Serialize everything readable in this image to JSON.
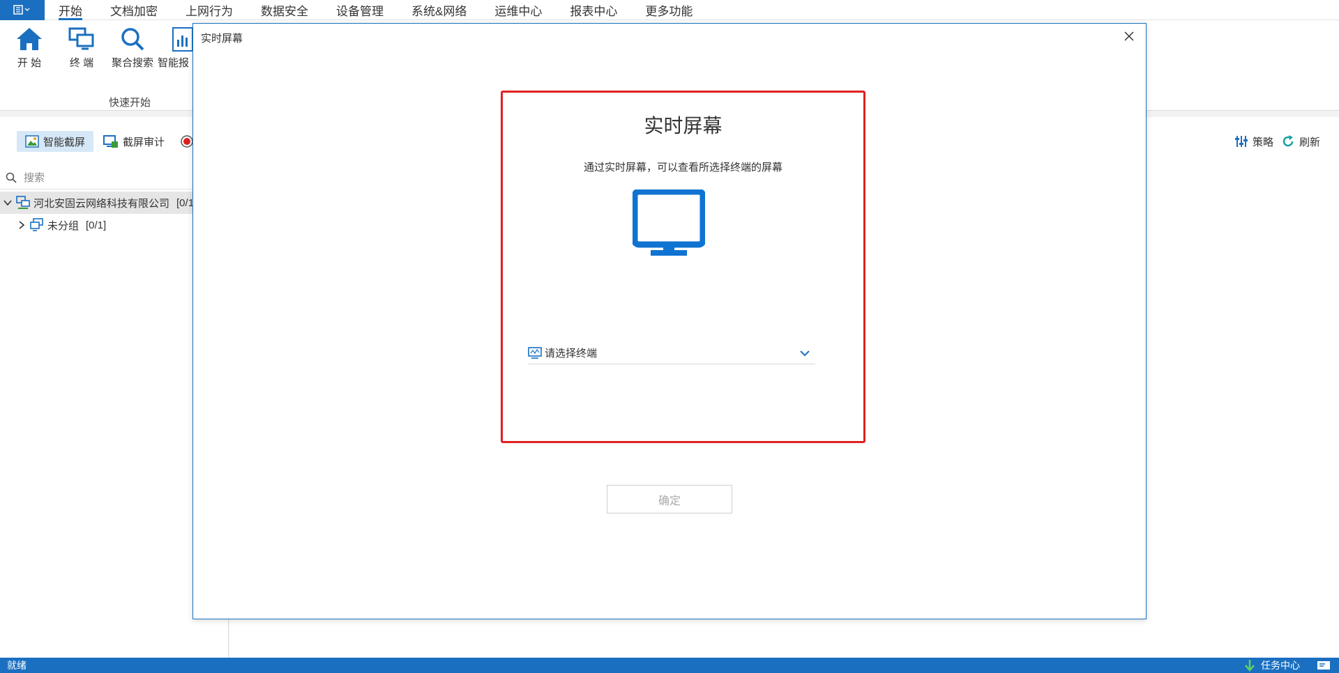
{
  "menubar": {
    "items": [
      "开始",
      "文档加密",
      "上网行为",
      "数据安全",
      "设备管理",
      "系统&网络",
      "运维中心",
      "报表中心",
      "更多功能"
    ]
  },
  "ribbon": {
    "buttons": [
      "开 始",
      "终 端",
      "聚合搜索",
      "智能报"
    ],
    "group_label": "快速开始"
  },
  "toolbar": {
    "smart_capture": "智能截屏",
    "capture_audit": "截屏审计",
    "policy": "策略",
    "refresh": "刷新"
  },
  "tree": {
    "search_placeholder": "搜索",
    "root_label": "河北安固云网络科技有限公司",
    "root_count": "[0/1",
    "child_label": "未分组",
    "child_count": "[0/1]"
  },
  "statusbar": {
    "status": "就绪",
    "task_center": "任务中心"
  },
  "modal": {
    "title": "实时屏幕",
    "heading": "实时屏幕",
    "description": "通过实时屏幕，可以查看所选择终端的屏幕",
    "select_placeholder": "请选择终端",
    "confirm_label": "确定"
  },
  "colors": {
    "accent": "#1a6fc0",
    "highlight": "#e02020",
    "monitor": "#0f73d2"
  }
}
